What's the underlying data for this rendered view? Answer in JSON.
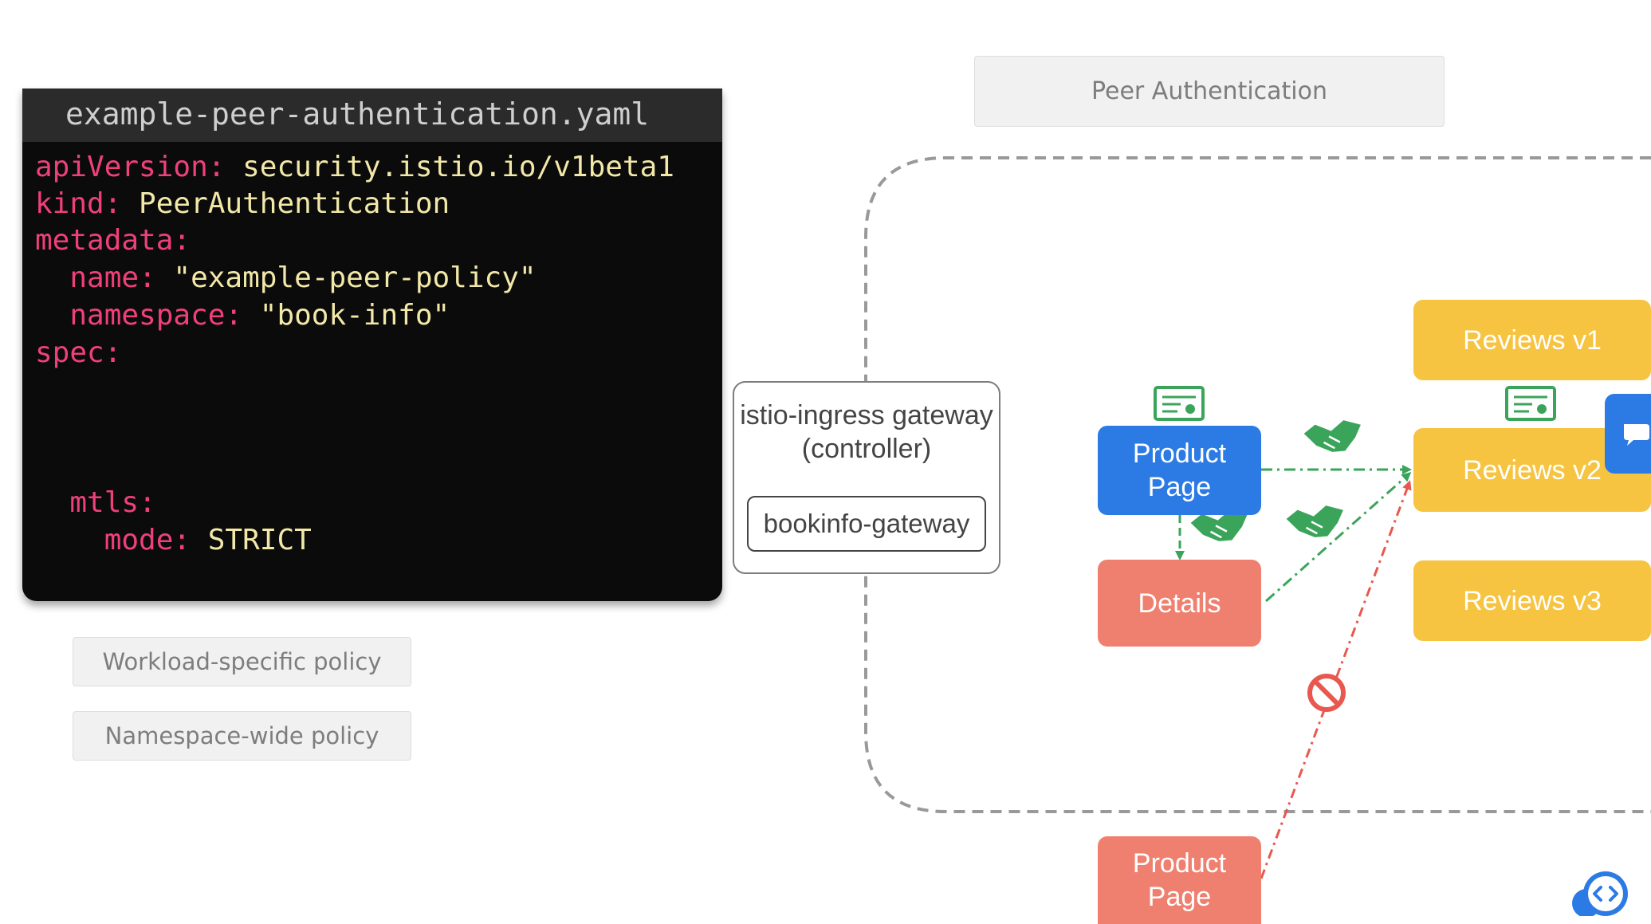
{
  "code": {
    "filename": "example-peer-authentication.yaml",
    "lines": [
      {
        "key": "apiVersion:",
        "value": " security.istio.io/v1beta1"
      },
      {
        "key": "kind:",
        "value": " PeerAuthentication"
      },
      {
        "key": "metadata:",
        "value": ""
      },
      {
        "key": "  name:",
        "value": " \"example-peer-policy\""
      },
      {
        "key": "  namespace:",
        "value": " \"book-info\""
      },
      {
        "key": "spec:",
        "value": ""
      },
      {
        "key": "  mtls:",
        "value": ""
      },
      {
        "key": "    mode:",
        "value": " STRICT"
      }
    ]
  },
  "policy_options": [
    "Workload-specific policy",
    "Namespace-wide policy"
  ],
  "diagram": {
    "title": "Peer Authentication",
    "gateway": {
      "label": "istio-ingress gateway (controller)",
      "inner": "bookinfo-gateway"
    },
    "services": {
      "product_page": "Product Page",
      "details": "Details",
      "reviews_v1": "Reviews v1",
      "reviews_v2": "Reviews v2",
      "reviews_v3": "Reviews v3",
      "external_product_page": "Product Page"
    }
  },
  "colors": {
    "blue": "#2c7be5",
    "salmon": "#ef8070",
    "yellow": "#f6c441",
    "green": "#3aa55a",
    "red": "#e9584f"
  },
  "icons": [
    "certificate-icon",
    "handshake-icon",
    "blocked-icon",
    "chat-icon",
    "logo-icon"
  ]
}
